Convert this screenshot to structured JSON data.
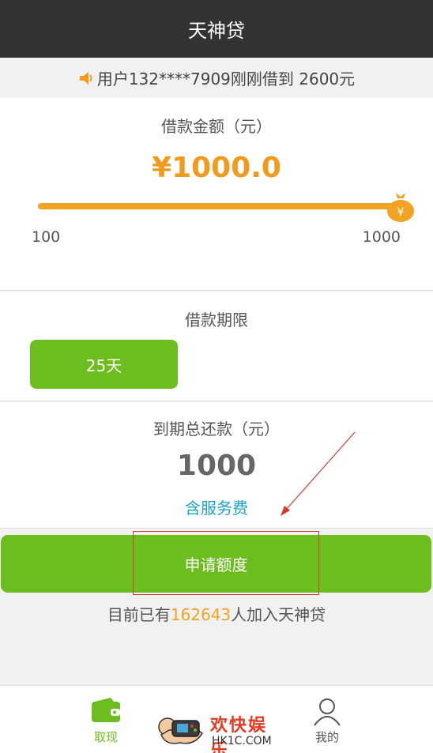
{
  "header": {
    "title": "天神贷"
  },
  "notice": {
    "text": "用户132****7909刚刚借到 2600元"
  },
  "loan_amount": {
    "label": "借款金额（元）",
    "value": "¥1000.0",
    "min_label": "100",
    "max_label": "1000",
    "slider_fraction": 1.0,
    "thumb_symbol": "¥"
  },
  "loan_term": {
    "label": "借款期限",
    "selected_option": "25天"
  },
  "repayment": {
    "label": "到期总还款（元）",
    "value": "1000",
    "note": "含服务费"
  },
  "apply_button": {
    "label": "申请额度"
  },
  "members": {
    "prefix": "目前已有",
    "count": "162643",
    "suffix": "人加入天神贷"
  },
  "tabbar": {
    "tabs": [
      {
        "label": "取现",
        "icon": "wallet-icon",
        "active": true
      },
      {
        "label": "我的",
        "icon": "user-icon",
        "active": false
      }
    ]
  },
  "watermark": {
    "title": "欢快娱乐",
    "url": "HK1C.COM"
  },
  "colors": {
    "primary_green": "#6cbd1e",
    "accent_orange": "#f29a1b",
    "link_blue": "#1aa3c4",
    "titlebar": "#333333"
  }
}
